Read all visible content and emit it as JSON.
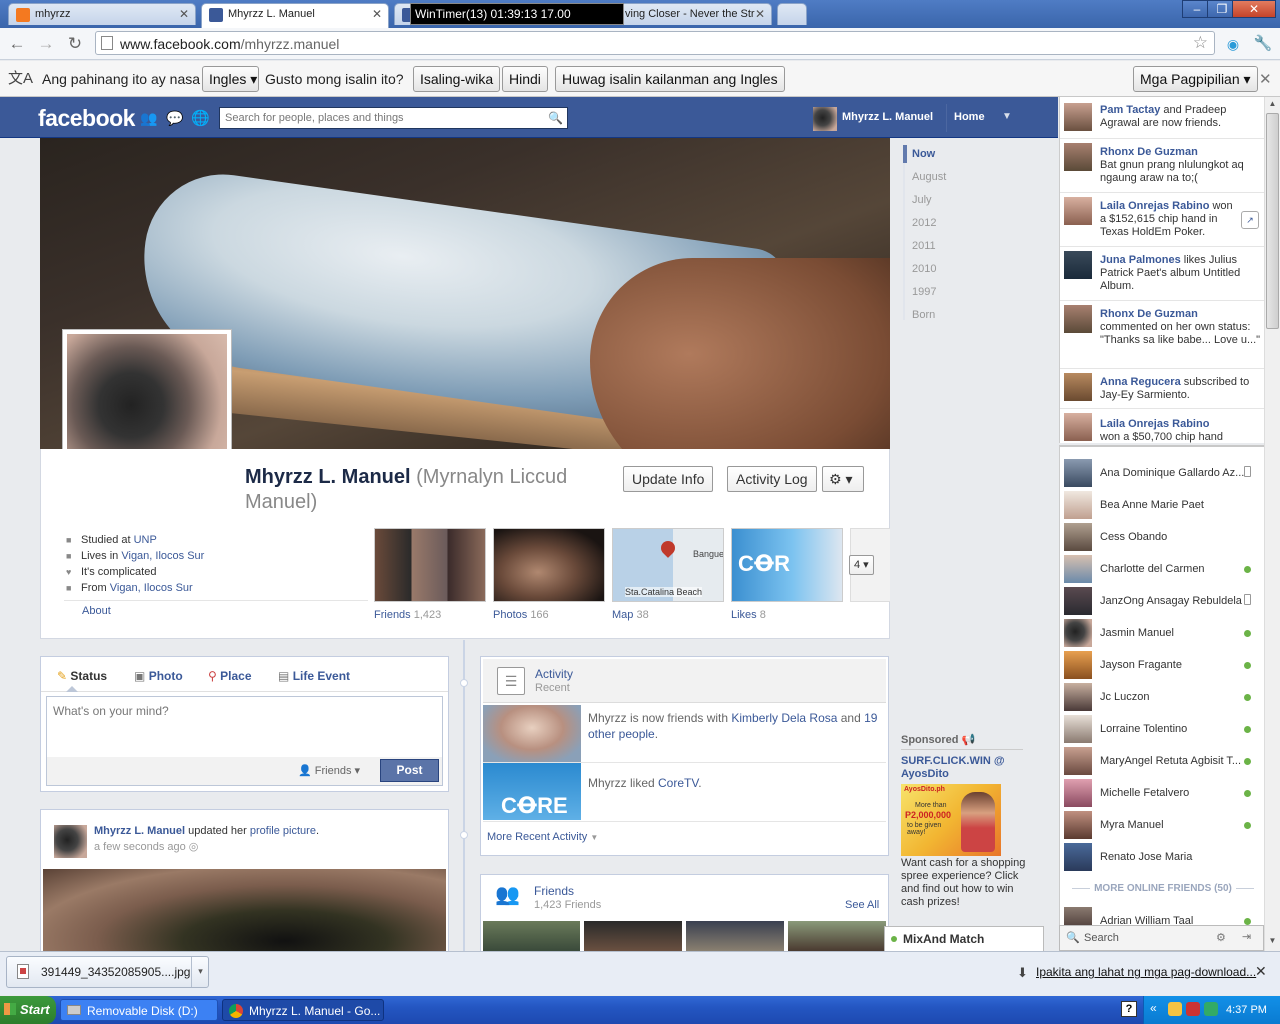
{
  "browser": {
    "tabs": [
      {
        "title": "mhyrzz",
        "favicon_color": "#f47920"
      },
      {
        "title": "Mhyrzz L. Manuel",
        "favicon_color": "#3b5998"
      },
      {
        "title": "ving Closer - Never the Str",
        "favicon_color": "#3b5998"
      }
    ],
    "win_timer": "WinTimer(13)  01:39:13  17.00",
    "url_host": "www.facebook.com",
    "url_path": "/mhyrzz.manuel",
    "window_controls": [
      "minimize",
      "restore",
      "close"
    ]
  },
  "translate_bar": {
    "text_before": "Ang pahinang ito ay nasa",
    "language": "Ingles",
    "question": "Gusto mong isalin ito?",
    "translate_button": "Isaling-wika",
    "no_button": "Hindi",
    "never_button": "Huwag isalin kailanman ang Ingles",
    "options_button": "Mga Pagpipilian"
  },
  "fb_header": {
    "logo": "facebook",
    "search_placeholder": "Search for people, places and things",
    "user_name": "Mhyrzz L. Manuel",
    "home_label": "Home"
  },
  "profile": {
    "name": "Mhyrzz L. Manuel",
    "alt_name": "(Myrnalyn Liccud Manuel)",
    "update_info": "Update Info",
    "activity_log": "Activity Log",
    "about": [
      {
        "prefix": "Studied at ",
        "link": "UNP",
        "icon": "school-icon"
      },
      {
        "prefix": "Lives in ",
        "link": "Vigan, Ilocos Sur",
        "icon": "home-icon"
      },
      {
        "prefix": "It's complicated",
        "link": "",
        "icon": "heart-icon"
      },
      {
        "prefix": "From ",
        "link": "Vigan, Ilocos Sur",
        "icon": "pin-icon"
      }
    ],
    "about_link": "About",
    "thumbnails": [
      {
        "label": "Friends",
        "count": "1,423"
      },
      {
        "label": "Photos",
        "count": "166"
      },
      {
        "label": "Map",
        "count": "38"
      },
      {
        "label": "Likes",
        "count": "8"
      }
    ],
    "map_place": "Sta.Catalina Beach",
    "map_place2": "Bangue",
    "more_count": "4"
  },
  "timeline_nav": [
    "Now",
    "August",
    "July",
    "2012",
    "2011",
    "2010",
    "1997",
    "Born"
  ],
  "composer": {
    "tabs": [
      "Status",
      "Photo",
      "Place",
      "Life Event"
    ],
    "placeholder": "What's on your mind?",
    "audience": "Friends",
    "post_button": "Post"
  },
  "post": {
    "author": "Mhyrzz L. Manuel",
    "action": " updated her ",
    "action_link": "profile picture",
    "action_end": ".",
    "time": "a few seconds ago"
  },
  "activity": {
    "title": "Activity",
    "subtitle": "Recent",
    "items": [
      {
        "text1": "Mhyrzz is now friends with ",
        "link1": "Kimberly Dela Rosa",
        "text2": " and ",
        "link2": "19 other people",
        "text3": "."
      },
      {
        "text1": "Mhyrzz liked ",
        "link1": "CoreTV",
        "text2": "",
        "link2": "",
        "text3": "."
      }
    ],
    "more": "More Recent Activity"
  },
  "friends_box": {
    "title": "Friends",
    "count": "1,423 Friends",
    "see_all": "See All"
  },
  "sponsored": {
    "label": "Sponsored",
    "ad_title": "SURF.CLICK.WIN @ AyosDito",
    "ad_image_text1": "AyosDito.ph",
    "ad_image_text2": "More than",
    "ad_image_text3": "P2,000,000",
    "ad_image_text4": "to be given away!",
    "ad_body": "Want cash for a shopping spree experience? Click and find out how to win cash prizes!"
  },
  "ticker": [
    {
      "name": "Pam Tactay",
      "rest": " and Pradeep Agrawal are now friends."
    },
    {
      "name": "Rhonx De Guzman",
      "rest": " Bat gnun prang nlulungkot aq ngaung araw na to;("
    },
    {
      "name": "Laila Onrejas Rabino",
      "rest": " won a $152,615 chip hand in Texas HoldEm Poker."
    },
    {
      "name": "Juna Palmones",
      "rest": " likes Julius Patrick Paet's album Untitled Album."
    },
    {
      "name": "Rhonx De Guzman",
      "rest": " commented on her own status: \"Thanks sa like babe... Love u...\""
    },
    {
      "name": "Anna Regucera",
      "rest": " subscribed to Jay-Ey Sarmiento."
    },
    {
      "name": "Laila Onrejas Rabino",
      "rest": " won a $50,700 chip hand"
    }
  ],
  "chat": {
    "people": [
      {
        "name": "Ana Dominique Gallardo Az...",
        "status": "mobile"
      },
      {
        "name": "Bea Anne Marie Paet",
        "status": "none"
      },
      {
        "name": "Cess Obando",
        "status": "none"
      },
      {
        "name": "Charlotte del Carmen",
        "status": "online"
      },
      {
        "name": "JanzOng Ansagay Rebuldela",
        "status": "mobile"
      },
      {
        "name": "Jasmin Manuel",
        "status": "online"
      },
      {
        "name": "Jayson Fragante",
        "status": "online"
      },
      {
        "name": "Jc Luczon",
        "status": "online"
      },
      {
        "name": "Lorraine Tolentino",
        "status": "online"
      },
      {
        "name": "MaryAngel Retuta Agbisit T...",
        "status": "online"
      },
      {
        "name": "Michelle Fetalvero",
        "status": "online"
      },
      {
        "name": "Myra Manuel",
        "status": "online"
      },
      {
        "name": "Renato Jose Maria",
        "status": "none"
      }
    ],
    "more_online": "MORE ONLINE FRIENDS (50)",
    "extra": {
      "name": "Adrian William Taal",
      "status": "online"
    },
    "search": "Search",
    "mixmatch": "MixAnd Match"
  },
  "download_bar": {
    "file": "391449_34352085905....jpg",
    "show_all": "Ipakita ang lahat ng mga pag-download..."
  },
  "taskbar": {
    "start": "Start",
    "items": [
      "Removable Disk (D:)",
      "Mhyrzz L. Manuel - Go..."
    ],
    "clock": "4:37 PM"
  }
}
